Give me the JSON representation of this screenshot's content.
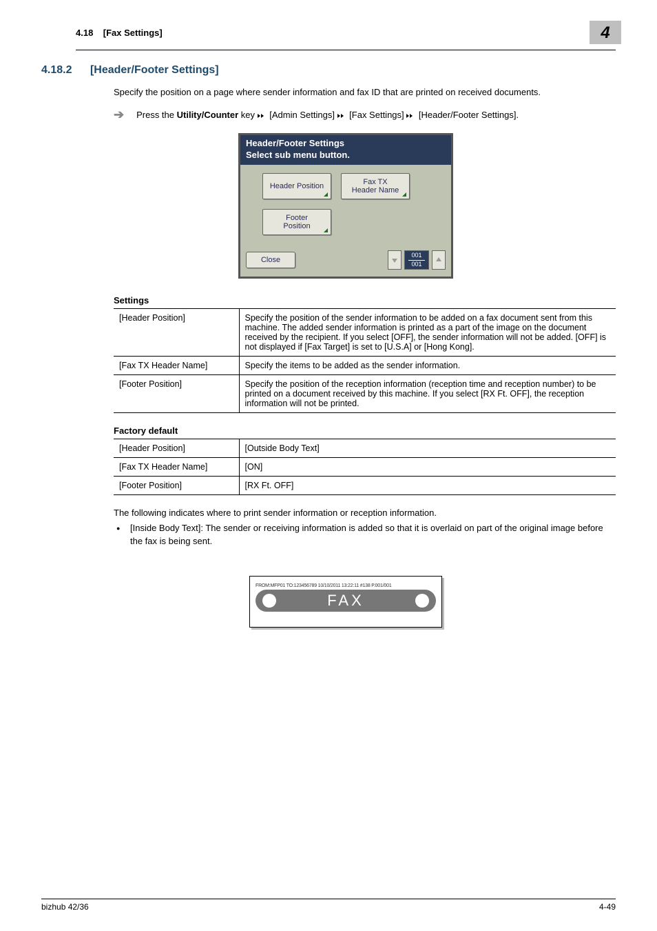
{
  "top": {
    "section_num": "4.18",
    "section_title": "[Fax Settings]",
    "chapter_num": "4"
  },
  "heading": {
    "num": "4.18.2",
    "title": "[Header/Footer Settings]"
  },
  "intro": "Specify the position on a page where sender information and fax ID that are printed on received documents.",
  "step": {
    "prefix": "Press the ",
    "key": "Utility/Counter",
    "after_key": " key ",
    "path1": " [Admin Settings] ",
    "path2": " [Fax Settings] ",
    "path3": " [Header/Footer Settings]."
  },
  "lcd": {
    "title_line1": "Header/Footer Settings",
    "title_line2": "Select sub menu button.",
    "btn_header_position": "Header Position",
    "btn_fax_tx_header_name_l1": "Fax TX",
    "btn_fax_tx_header_name_l2": "Header Name",
    "btn_footer_position_l1": "Footer",
    "btn_footer_position_l2": "Position",
    "close": "Close",
    "page_top": "001",
    "page_bot": "001"
  },
  "settings_caption": "Settings",
  "settings_rows": [
    {
      "k": "[Header Position]",
      "v": "Specify the position of the sender information to be added on a fax document sent from this machine. The added sender information is printed as a part of the image on the document received by the recipient. If you select [OFF], the sender information will not be added. [OFF] is not displayed if [Fax Target] is set to [U.S.A] or [Hong Kong]."
    },
    {
      "k": "[Fax TX Header Name]",
      "v": "Specify the items to be added as the sender information."
    },
    {
      "k": "[Footer Position]",
      "v": "Specify the position of the reception information (reception time and reception number) to be printed on a document received by this machine. If you select [RX Ft. OFF], the reception information will not be printed."
    }
  ],
  "defaults_caption": "Factory default",
  "defaults_rows": [
    {
      "k": "[Header Position]",
      "v": "[Outside Body Text]"
    },
    {
      "k": "[Fax TX Header Name]",
      "v": "[ON]"
    },
    {
      "k": "[Footer Position]",
      "v": "[RX Ft. OFF]"
    }
  ],
  "after_para": "The following indicates where to print sender information or reception information.",
  "bullet": "[Inside Body Text]: The sender or receiving information is added so that it is overlaid on part of the original image before the fax is being sent.",
  "fax_ill": {
    "header_line": "FROM:MFP01 TO:123456789 10/10/2011 13:22:11 #138 P.001/001",
    "fax_word": "FAX"
  },
  "footer": {
    "left": "bizhub 42/36",
    "right": "4-49"
  }
}
